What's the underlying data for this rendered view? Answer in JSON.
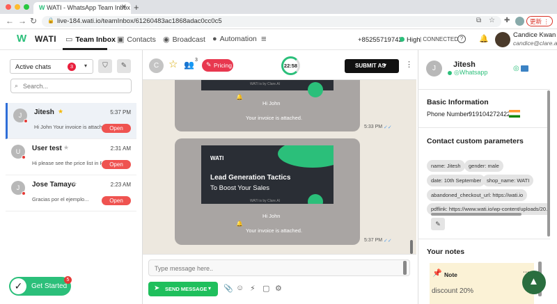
{
  "browser": {
    "tab_title": "WATI - WhatsApp Team Inbox",
    "close": "✕",
    "new_tab": "+",
    "url": "live-184.wati.io/teamInbox/61260483ac1868adac0cc0c5",
    "update_label": "更新"
  },
  "app": {
    "brand": "WATI",
    "nav": [
      {
        "label": "Team Inbox"
      },
      {
        "label": "Contacts"
      },
      {
        "label": "Broadcast"
      },
      {
        "label": "Automation"
      }
    ],
    "phone": "+85255719742",
    "quality": "High",
    "connection": "CONNECTED",
    "user_name": "Candice Kwan",
    "user_email": "candice@clare.ai"
  },
  "inbox": {
    "filter_label": "Active chats",
    "filter_count": "3",
    "search_placeholder": "Search...",
    "chats": [
      {
        "initial": "J",
        "name": "Jitesh",
        "time": "5:37 PM",
        "preview": "Hi John Your invoice is attached...",
        "status": "Open"
      },
      {
        "initial": "U",
        "name": "User test",
        "time": "2:31 AM",
        "preview": "Hi please see the price list in PDF.",
        "status": "Open"
      },
      {
        "initial": "J",
        "name": "Jose Tamayo",
        "time": "2:23 AM",
        "preview": "Gracias por el ejemplo...",
        "status": "Open"
      }
    ]
  },
  "chat_header": {
    "avatar_initial": "C",
    "assign_badge": "3",
    "pricing_label": "Pricing",
    "timer": "22:58",
    "submit_label": "SUBMIT AS"
  },
  "messages": [
    {
      "watermark": "WATI is by Clare.AI",
      "greeting": "Hi John",
      "body": "Your invoice is attached.",
      "time": "5:33 PM"
    },
    {
      "brand": "WATI",
      "headline": "Lead Generation Tactics",
      "subline": "To Boost Your Sales",
      "watermark": "WATI is by Clare.AI",
      "greeting": "Hi John",
      "body": "Your invoice is attached.",
      "time": "5:37 PM"
    }
  ],
  "composer": {
    "placeholder": "Type message here..",
    "send_label": "SEND MESSAGE"
  },
  "get_started": {
    "label": "Get Started",
    "badge": "5"
  },
  "contact": {
    "initial": "J",
    "name": "Jitesh",
    "channel": "Whatsapp",
    "basic_title": "Basic Information",
    "phone_label": "Phone Number:",
    "phone_value": "919104272422",
    "params_title": "Contact custom parameters",
    "params": [
      "name: Jitesh",
      "gender: male",
      "date: 10th September",
      "shop_name: WATI",
      "abandoned_checkout_url: https://wati.io",
      "pdflink: https://www.wati.io/wp-content/uploads/20..."
    ],
    "notes_title": "Your notes",
    "note_label": "Note",
    "note_text": "discount 20%"
  },
  "colors": {
    "brand_green": "#2bbf7a",
    "open_red": "#ef5350",
    "send_green": "#1fbf5c",
    "pricing_red": "#e8384f"
  }
}
